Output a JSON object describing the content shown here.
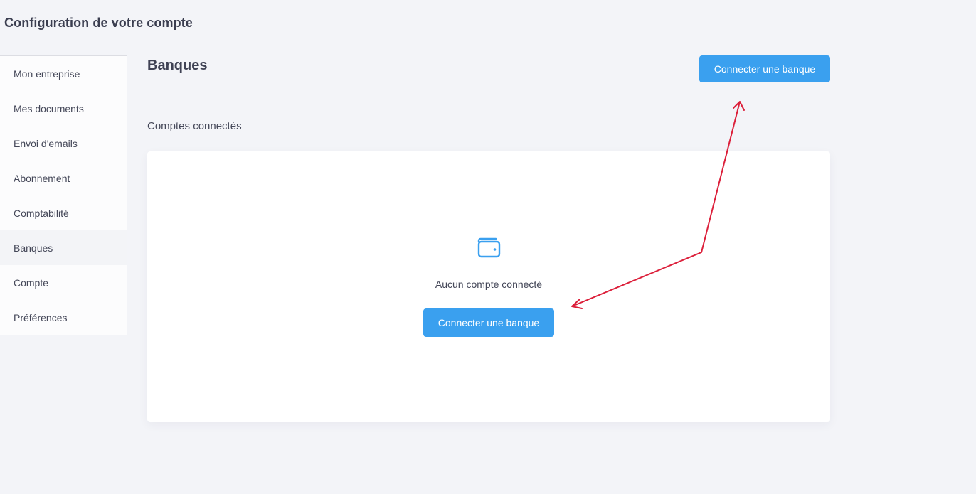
{
  "header": {
    "title": "Configuration de votre compte"
  },
  "sidebar": {
    "items": [
      {
        "label": "Mon entreprise"
      },
      {
        "label": "Mes documents"
      },
      {
        "label": "Envoi d'emails"
      },
      {
        "label": "Abonnement"
      },
      {
        "label": "Comptabilité"
      },
      {
        "label": "Banques"
      },
      {
        "label": "Compte"
      },
      {
        "label": "Préférences"
      }
    ],
    "active_label": "Banques"
  },
  "main": {
    "section_title": "Banques",
    "connect_button_label": "Connecter une banque",
    "connected_accounts_heading": "Comptes connectés",
    "empty_state": {
      "icon": "wallet-icon",
      "message": "Aucun compte connecté",
      "button_label": "Connecter une banque"
    }
  },
  "colors": {
    "accent": "#3aa0ef",
    "annotation_arrow": "#dc1f3a",
    "background": "#f3f4f8"
  }
}
